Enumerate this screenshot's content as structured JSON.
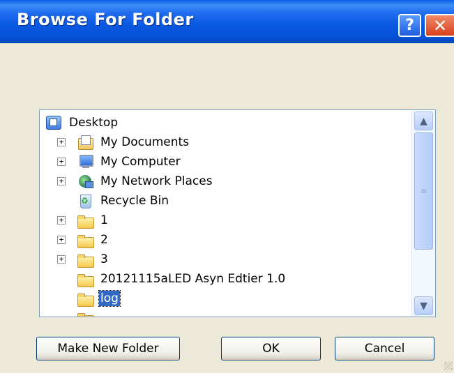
{
  "window": {
    "title": "Browse For Folder",
    "help_glyph": "?",
    "close_glyph": "✕"
  },
  "tree": {
    "items": [
      {
        "label": "Desktop",
        "icon": "desktop-icon",
        "expander": ""
      },
      {
        "label": "My Documents",
        "icon": "documents-folder-icon",
        "expander": "+"
      },
      {
        "label": "My Computer",
        "icon": "computer-icon",
        "expander": "+"
      },
      {
        "label": "My Network Places",
        "icon": "network-places-icon",
        "expander": "+"
      },
      {
        "label": "Recycle Bin",
        "icon": "recycle-bin-icon",
        "expander": ""
      },
      {
        "label": "1",
        "icon": "folder-icon",
        "expander": "+"
      },
      {
        "label": "2",
        "icon": "folder-icon",
        "expander": "+"
      },
      {
        "label": "3",
        "icon": "folder-icon",
        "expander": "+"
      },
      {
        "label": "20121115aLED Asyn Edtier 1.0",
        "icon": "folder-icon",
        "expander": ""
      },
      {
        "label": "log",
        "icon": "folder-icon",
        "expander": "",
        "selected": true
      }
    ]
  },
  "scrollbar": {
    "up_glyph": "▲",
    "down_glyph": "▼",
    "grip_glyph": "≡"
  },
  "buttons": {
    "make_new_folder": "Make New Folder",
    "ok": "OK",
    "cancel": "Cancel"
  }
}
